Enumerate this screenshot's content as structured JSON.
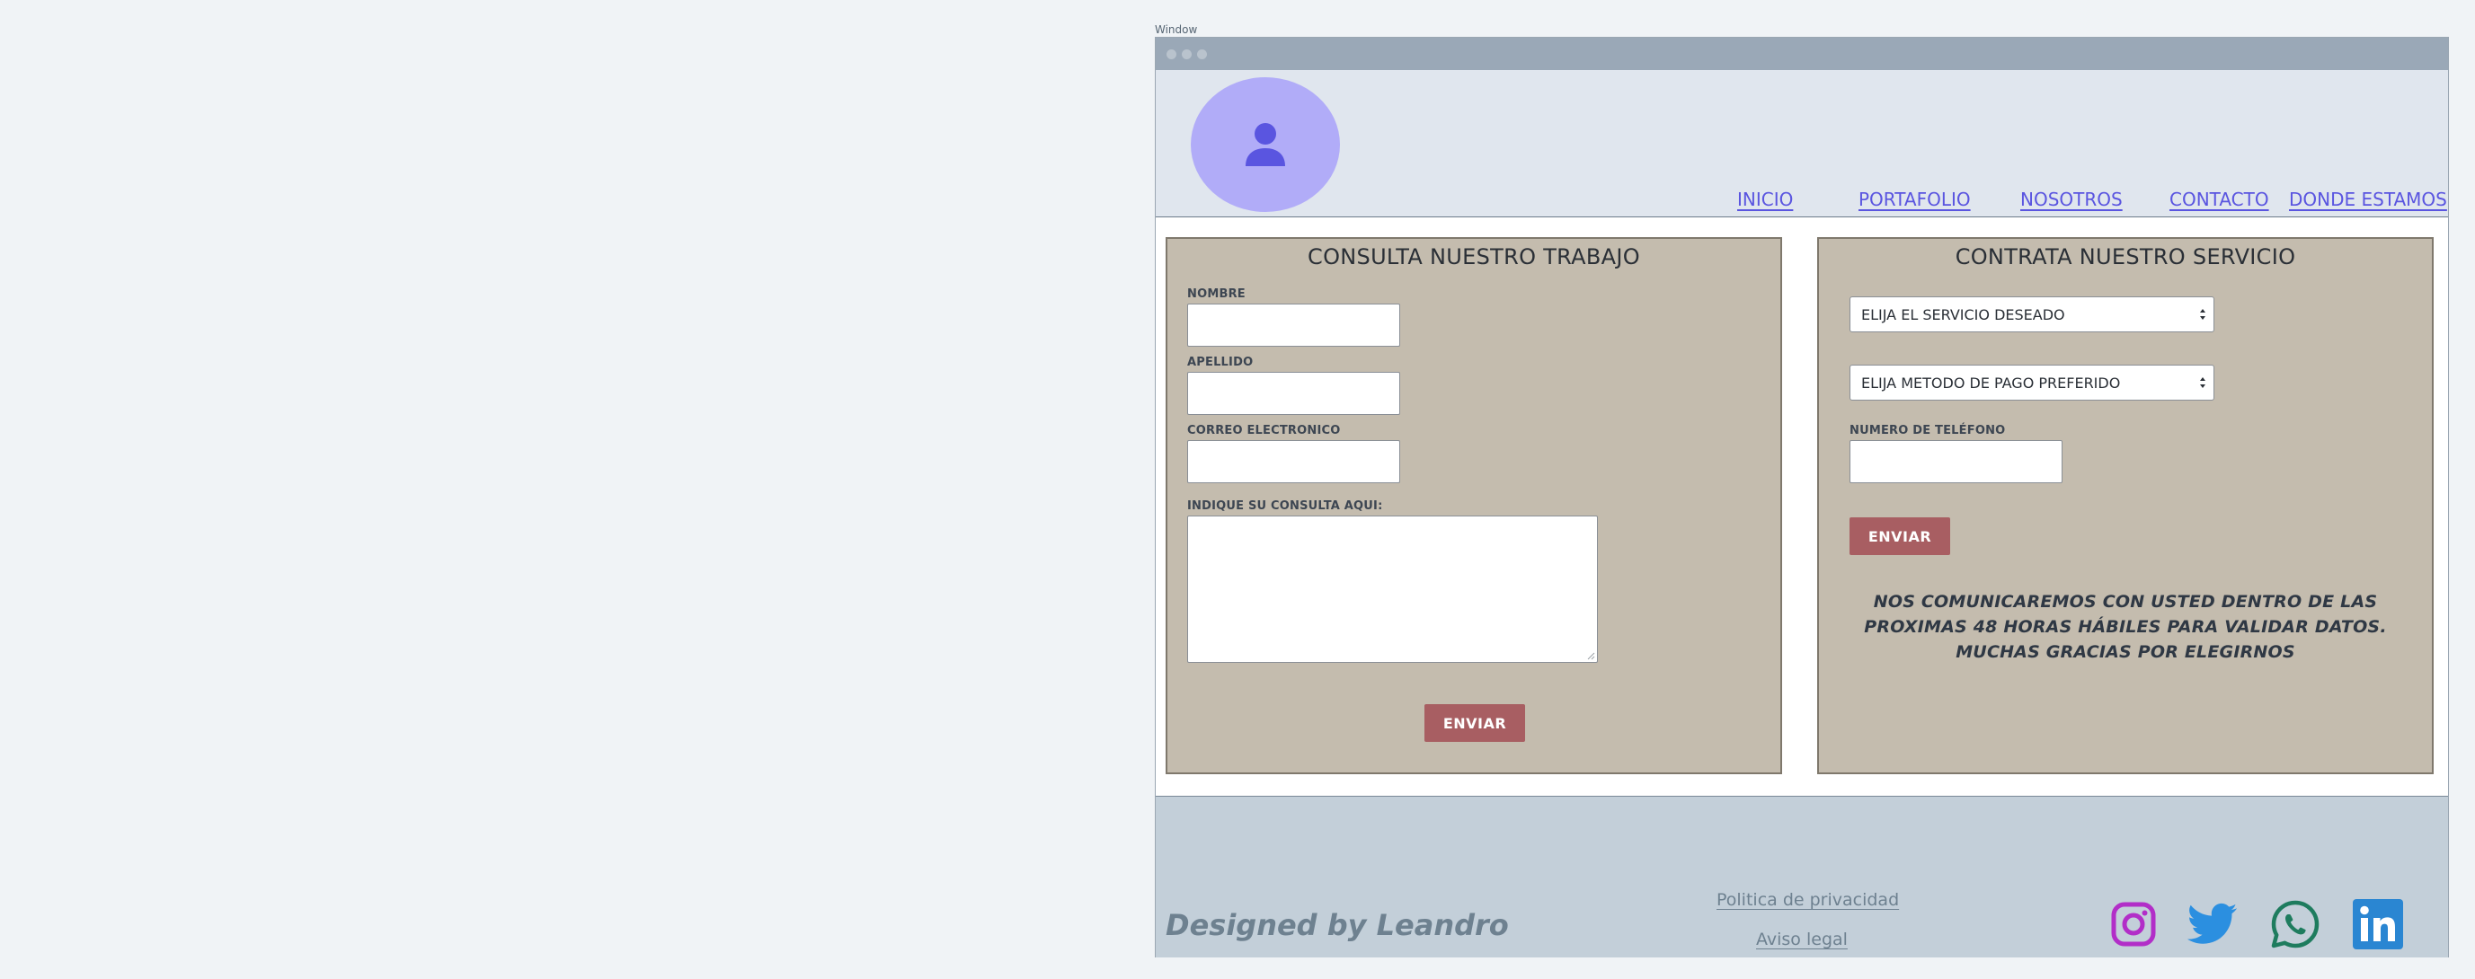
{
  "window": {
    "label": "Window"
  },
  "nav": [
    {
      "label": "INICIO"
    },
    {
      "label": "PORTAFOLIO"
    },
    {
      "label": "NOSOTROS"
    },
    {
      "label": "CONTACTO"
    },
    {
      "label": "DONDE ESTAMOS"
    }
  ],
  "consulta": {
    "title": "CONSULTA NUESTRO TRABAJO",
    "nombre_label": "NOMBRE",
    "nombre_value": "",
    "apellido_label": "APELLIDO",
    "apellido_value": "",
    "correo_label": "CORREO ELECTRONICO",
    "correo_value": "",
    "consulta_label": "INDIQUE SU CONSULTA AQUI:",
    "consulta_value": "",
    "submit_label": "ENVIAR"
  },
  "contrata": {
    "title": "CONTRATA NUESTRO SERVICIO",
    "servicio_selected": "ELIJA EL SERVICIO DESEADO",
    "pago_selected": "ELIJA METODO DE PAGO PREFERIDO",
    "telefono_label": "NUMERO DE TELÉFONO",
    "telefono_value": "",
    "submit_label": "ENVIAR",
    "notice_line1": "NOS COMUNICAREMOS CON USTED DENTRO DE LAS",
    "notice_line2": "PROXIMAS 48 HORAS HÁBILES PARA VALIDAR DATOS.",
    "notice_line3": "MUCHAS GRACIAS POR ELEGIRNOS"
  },
  "footer": {
    "designed_by": "Designed by Leandro",
    "privacy_link": "Politica de privacidad",
    "legal_link": "Aviso legal"
  },
  "icons": {
    "avatar": "user-icon",
    "instagram": "instagram-icon",
    "twitter": "twitter-icon",
    "whatsapp": "whatsapp-icon",
    "linkedin": "linkedin-icon"
  },
  "colors": {
    "nav_link": "#5a55e0",
    "avatar_bg": "#b1acf8",
    "panel_bg": "#c4bcae",
    "button_bg": "#a85e62",
    "instagram": "#b22ec8",
    "twitter": "#2b8fe0",
    "whatsapp": "#1e7c5e",
    "linkedin": "#2a86d2"
  }
}
